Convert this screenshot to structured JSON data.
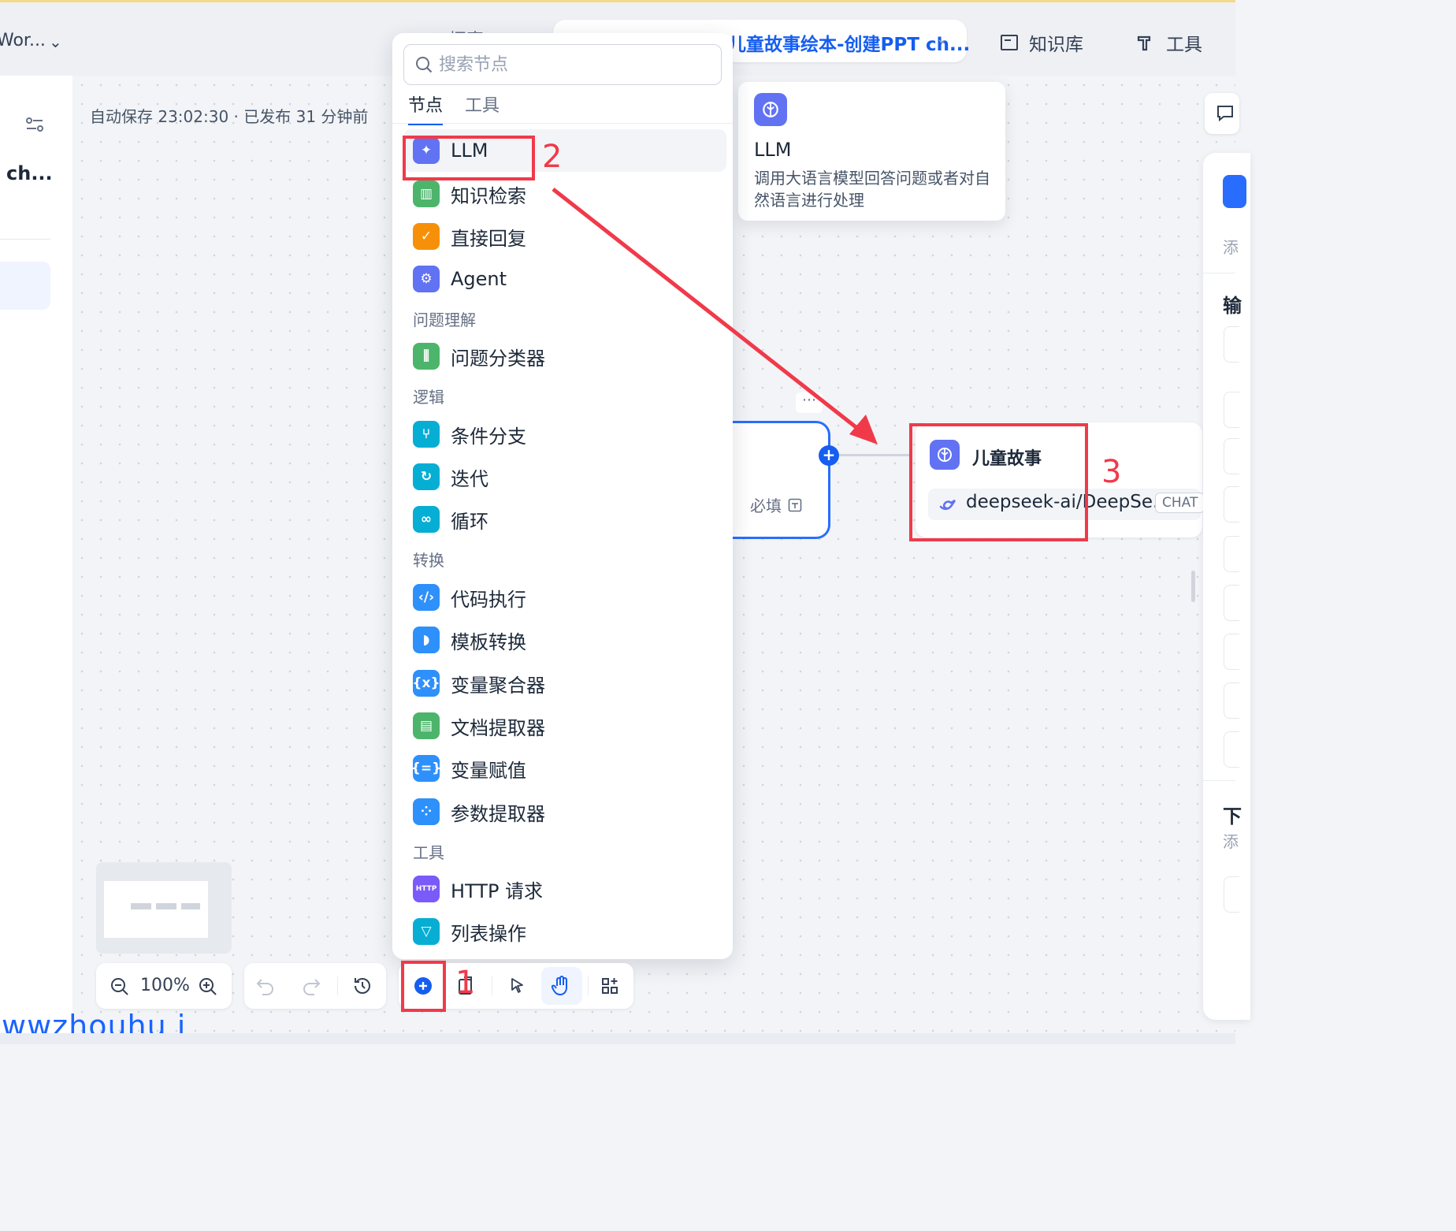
{
  "header": {
    "workspace": "Wor...",
    "faded_nav": "探索",
    "app_title": "儿童故事绘本-创建PPT ch...",
    "knowledge_base": "知识库",
    "tools": "工具"
  },
  "sidebar": {
    "app_short_name": "ch..."
  },
  "canvas": {
    "autosave": "自动保存 23:02:30 · 已发布 31 分钟前"
  },
  "node_panel": {
    "search_placeholder": "搜索节点",
    "tabs": [
      "节点",
      "工具"
    ],
    "items": [
      {
        "label": "LLM",
        "icon": "llm-icon",
        "color": "#6172f3"
      },
      {
        "label": "知识检索",
        "icon": "book-icon",
        "color": "#4cb56b"
      },
      {
        "label": "直接回复",
        "icon": "reply-icon",
        "color": "#f79009"
      },
      {
        "label": "Agent",
        "icon": "agent-icon",
        "color": "#6172f3"
      }
    ],
    "cat_understanding": "问题理解",
    "classifier": {
      "label": "问题分类器",
      "icon": "classifier-icon",
      "color": "#4cb56b"
    },
    "cat_logic": "逻辑",
    "logic_items": [
      {
        "label": "条件分支",
        "icon": "branch-icon",
        "color": "#06aed4"
      },
      {
        "label": "迭代",
        "icon": "iteration-icon",
        "color": "#06aed4"
      },
      {
        "label": "循环",
        "icon": "loop-icon",
        "color": "#06aed4"
      }
    ],
    "cat_transform": "转换",
    "transform_items": [
      {
        "label": "代码执行",
        "icon": "code-icon",
        "color": "#2e90fa"
      },
      {
        "label": "模板转换",
        "icon": "template-icon",
        "color": "#2e90fa"
      },
      {
        "label": "变量聚合器",
        "icon": "variable-icon",
        "color": "#2e90fa"
      },
      {
        "label": "文档提取器",
        "icon": "doc-extract-icon",
        "color": "#4cb56b"
      },
      {
        "label": "变量赋值",
        "icon": "assign-icon",
        "color": "#2e90fa"
      },
      {
        "label": "参数提取器",
        "icon": "param-icon",
        "color": "#2e90fa"
      }
    ],
    "cat_tools": "工具",
    "tool_items": [
      {
        "label": "HTTP 请求",
        "icon": "http-icon",
        "color": "#7a5af8"
      },
      {
        "label": "列表操作",
        "icon": "filter-icon",
        "color": "#06aed4"
      }
    ]
  },
  "tooltip": {
    "title": "LLM",
    "description": "调用大语言模型回答问题或者对自然语言进行处理"
  },
  "workflow": {
    "required_label": "必填",
    "node_title": "儿童故事",
    "model_name": "deepseek-ai/DeepSe...",
    "model_badge": "CHAT"
  },
  "right_panel": {
    "partial_char_1": "添",
    "partial_char_2": "输",
    "partial_char_3": "下",
    "partial_char_4": "添"
  },
  "toolbar": {
    "zoom": "100%"
  },
  "annotations": {
    "step1": "1",
    "step2": "2",
    "step3": "3",
    "accent": "#f03a4a"
  },
  "watermark": "wwzhouhu i"
}
